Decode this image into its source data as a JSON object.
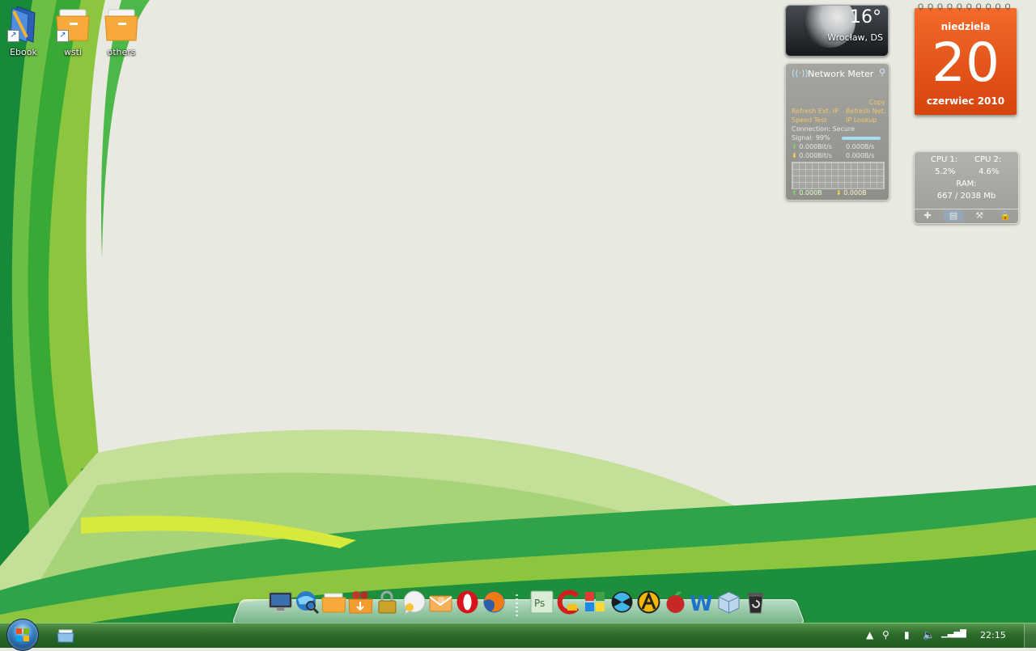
{
  "desktop_icons": [
    {
      "label": "Ebook",
      "icon": "ebook-shortcut-icon"
    },
    {
      "label": "wsti",
      "icon": "folder-shortcut-icon"
    },
    {
      "label": "others",
      "icon": "folder-icon"
    }
  ],
  "weather": {
    "temperature": "16°",
    "city": "Wrocław, DS",
    "icon": "moon-icon"
  },
  "network_meter": {
    "title": "Network Meter",
    "copy": "Copy",
    "refresh_ext_ip": "Refresh Ext. IP",
    "refresh_net": "Refresh Net.",
    "speed_test": "Speed Test",
    "ip_lookup": "IP Lookup",
    "connection": "Connection: Secure",
    "signal": "Signal: 99%",
    "signal_level": 0.99,
    "upload_bits": "0.000Bit/s",
    "upload_bytes": "0.000B/s",
    "download_bits": "0.000Bit/s",
    "download_bytes": "0.000B/s",
    "total_up": "0.000B",
    "total_down": "0.000B"
  },
  "calendar": {
    "weekday": "niedziela",
    "day": "20",
    "month_year": "czerwiec 2010"
  },
  "cpu_meter": {
    "cpu1_label": "CPU 1:",
    "cpu1_value": "5.2%",
    "cpu2_label": "CPU 2:",
    "cpu2_value": "4.6%",
    "ram_label": "RAM:",
    "ram_value": "667 / 2038 Mb",
    "tools": [
      "plus-icon",
      "meter-icon",
      "wrench-icon",
      "lock-icon"
    ]
  },
  "dock": {
    "items": [
      "computer-icon",
      "globe-search-icon",
      "folder-icon",
      "downloads-icon",
      "lock-icon",
      "chat-icon",
      "mail-icon",
      "opera-icon",
      "firefox-icon",
      "photoshop-icon",
      "ccleaner-icon",
      "cube-icon",
      "radiation-icon",
      "aimp-icon",
      "fruit-icon",
      "word-icon",
      "virtualbox-icon",
      "recycle-bin-icon"
    ]
  },
  "taskbar": {
    "clock": "22:15",
    "tray_icons": [
      "tray-arrow-icon",
      "network-tray-icon",
      "battery-icon",
      "volume-icon",
      "signal-icon"
    ]
  },
  "colors": {
    "calendar_orange": "#e2531a",
    "taskbar_green": "#2c6b2a",
    "wallpaper_green": "#3aa53a"
  }
}
